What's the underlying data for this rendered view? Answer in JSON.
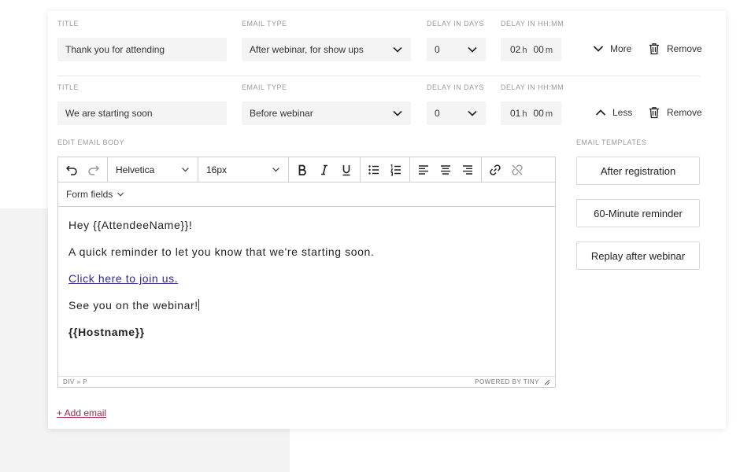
{
  "rows": [
    {
      "title_label": "TITLE",
      "title_value": "Thank you for attending",
      "type_label": "EMAIL TYPE",
      "type_value": "After webinar, for show ups",
      "days_label": "DELAY IN DAYS",
      "days_value": "0",
      "time_label": "DELAY IN HH:MM",
      "hours": "02",
      "hours_unit": "h",
      "minutes": "00",
      "minutes_unit": "m",
      "toggle_label": "More",
      "remove_label": "Remove"
    },
    {
      "title_label": "TITLE",
      "title_value": "We are starting soon",
      "type_label": "EMAIL TYPE",
      "type_value": "Before webinar",
      "days_label": "DELAY IN DAYS",
      "days_value": "0",
      "time_label": "DELAY IN HH:MM",
      "hours": "01",
      "hours_unit": "h",
      "minutes": "00",
      "minutes_unit": "m",
      "toggle_label": "Less",
      "remove_label": "Remove"
    }
  ],
  "editor": {
    "label": "EDIT EMAIL BODY",
    "font_family": "Helvetica",
    "font_size": "16px",
    "form_fields_label": "Form fields",
    "body": {
      "greeting": "Hey {{AttendeeName}}!",
      "reminder": "A quick reminder to let you know that we're starting soon.",
      "link": "Click here to join us.",
      "closing": "See you on the webinar!",
      "signature": "{{Hostname}}"
    },
    "path": "DIV » P",
    "powered_by": "POWERED BY TINY"
  },
  "templates": {
    "label": "EMAIL TEMPLATES",
    "items": [
      "After registration",
      "60-Minute reminder",
      "Replay after webinar"
    ]
  },
  "add_email_label": "+ Add email",
  "colors": {
    "link": "#2d2a8f",
    "accent": "#a02846",
    "field_bg": "#f4f4f5"
  }
}
